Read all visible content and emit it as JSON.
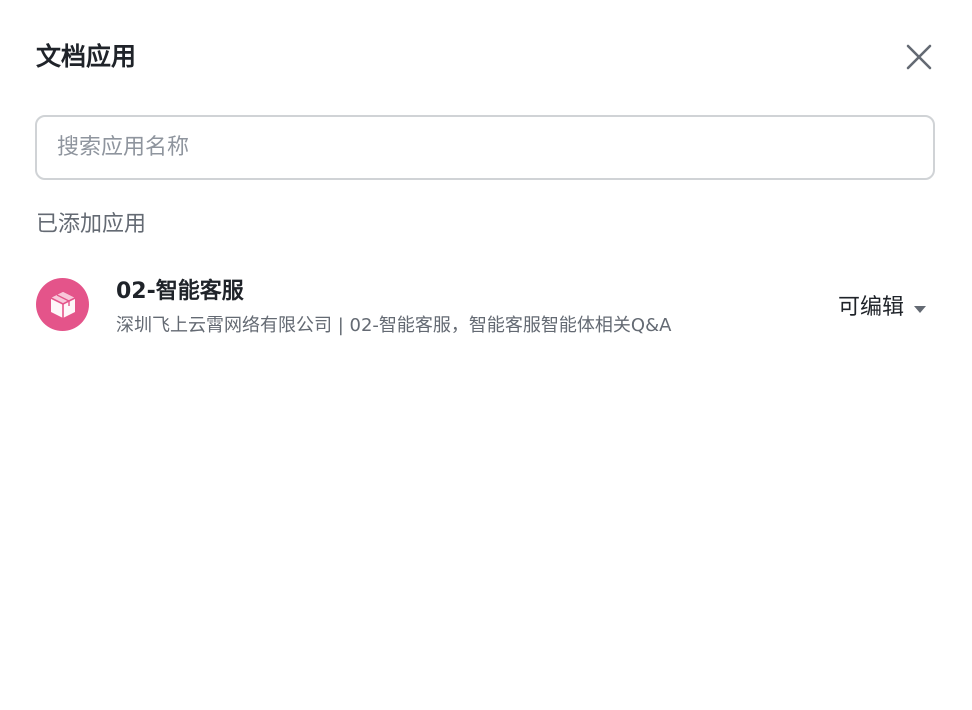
{
  "dialog": {
    "title": "文档应用",
    "close_icon": "close-icon"
  },
  "search": {
    "placeholder": "搜索应用名称",
    "value": ""
  },
  "added_section": {
    "label": "已添加应用",
    "apps": [
      {
        "icon": "cube-icon",
        "icon_bg": "#e4548a",
        "name": "02-智能客服",
        "description": "深圳飞上云霄网络有限公司 | 02-智能客服，智能客服智能体相关Q&A",
        "permission": "可编辑",
        "permission_icon": "caret-down-icon"
      }
    ]
  }
}
